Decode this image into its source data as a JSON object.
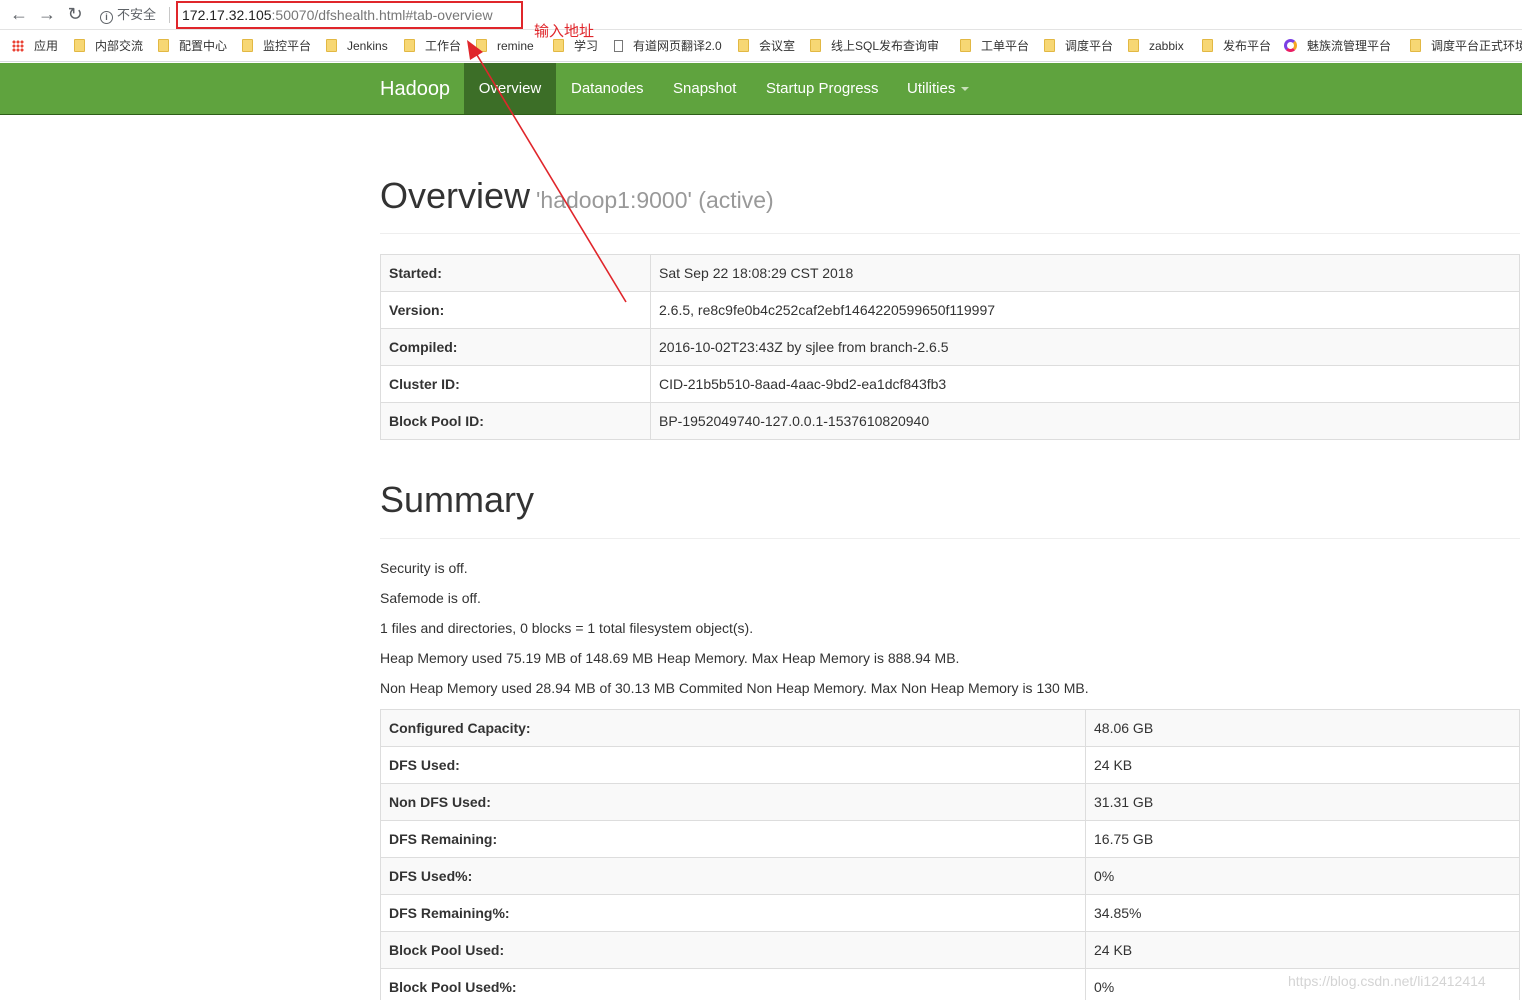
{
  "browser": {
    "security_label": "不安全",
    "url_host": "172.17.32.105",
    "url_path": ":50070/dfshealth.html#tab-overview",
    "bookmarks": [
      "应用",
      "内部交流",
      "配置中心",
      "监控平台",
      "Jenkins",
      "工作台",
      "remine",
      "学习",
      "有道网页翻译2.0",
      "会议室",
      "线上SQL发布查询审",
      "工单平台",
      "调度平台",
      "zabbix",
      "发布平台",
      "魅族流管理平台",
      "调度平台正式环境"
    ]
  },
  "annotation": {
    "text": "输入地址",
    "color": "#e0262b"
  },
  "navbar": {
    "brand": "Hadoop",
    "items": [
      "Overview",
      "Datanodes",
      "Snapshot",
      "Startup Progress",
      "Utilities"
    ],
    "active": "Overview",
    "color": "#5fa33e"
  },
  "overview": {
    "title": "Overview",
    "subtitle": "'hadoop1:9000' (active)",
    "rows": [
      {
        "key": "Started:",
        "value": "Sat Sep 22 18:08:29 CST 2018"
      },
      {
        "key": "Version:",
        "value": "2.6.5, re8c9fe0b4c252caf2ebf1464220599650f119997"
      },
      {
        "key": "Compiled:",
        "value": "2016-10-02T23:43Z by sjlee from branch-2.6.5"
      },
      {
        "key": "Cluster ID:",
        "value": "CID-21b5b510-8aad-4aac-9bd2-ea1dcf843fb3"
      },
      {
        "key": "Block Pool ID:",
        "value": "BP-1952049740-127.0.0.1-1537610820940"
      }
    ]
  },
  "summary": {
    "title": "Summary",
    "lines": [
      "Security is off.",
      "Safemode is off.",
      "1 files and directories, 0 blocks = 1 total filesystem object(s).",
      "Heap Memory used 75.19 MB of 148.69 MB Heap Memory. Max Heap Memory is 888.94 MB.",
      "Non Heap Memory used 28.94 MB of 30.13 MB Commited Non Heap Memory. Max Non Heap Memory is 130 MB."
    ],
    "rows": [
      {
        "key": "Configured Capacity:",
        "value": "48.06 GB"
      },
      {
        "key": "DFS Used:",
        "value": "24 KB"
      },
      {
        "key": "Non DFS Used:",
        "value": "31.31 GB"
      },
      {
        "key": "DFS Remaining:",
        "value": "16.75 GB"
      },
      {
        "key": "DFS Used%:",
        "value": "0%"
      },
      {
        "key": "DFS Remaining%:",
        "value": "34.85%"
      },
      {
        "key": "Block Pool Used:",
        "value": "24 KB"
      },
      {
        "key": "Block Pool Used%:",
        "value": "0%"
      }
    ]
  },
  "watermark": "https://blog.csdn.net/li12412414"
}
